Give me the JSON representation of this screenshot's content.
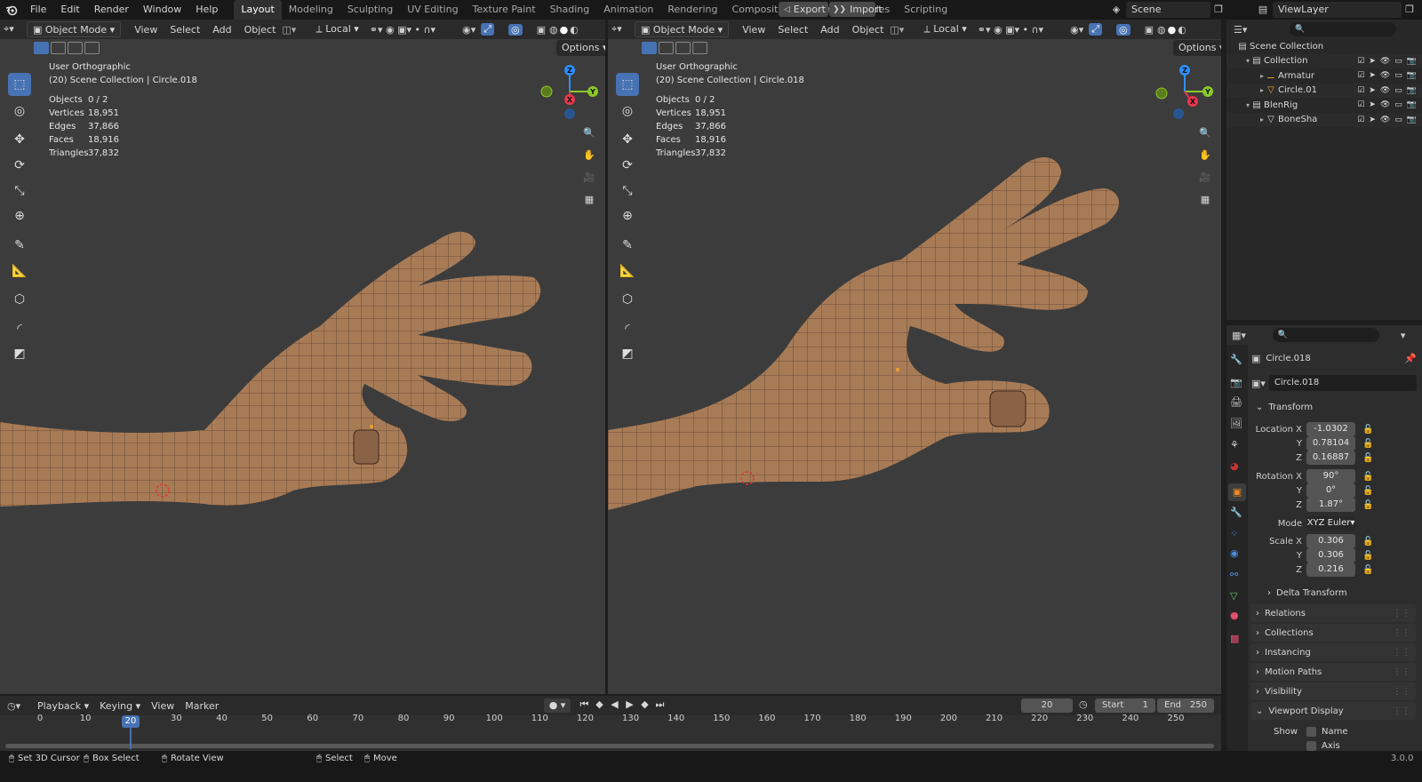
{
  "topbar": {
    "menus": [
      "File",
      "Edit",
      "Render",
      "Window",
      "Help"
    ],
    "workspaces": [
      "Layout",
      "Modeling",
      "Sculpting",
      "UV Editing",
      "Texture Paint",
      "Shading",
      "Animation",
      "Rendering",
      "Compositing",
      "Geometry Nodes",
      "Scripting"
    ],
    "active_workspace": "Layout",
    "export_label": "Export",
    "import_label": "Import",
    "scene_name": "Scene",
    "view_layer": "ViewLayer"
  },
  "viewport_header": {
    "mode": "Object Mode",
    "menus": [
      "View",
      "Select",
      "Add",
      "Object"
    ],
    "orientation": "Local",
    "options_label": "Options"
  },
  "viewport_left": {
    "view_name": "User Orthographic",
    "collection": "(20) Scene Collection | Circle.018",
    "stats": [
      {
        "label": "Objects",
        "value": "0 / 2"
      },
      {
        "label": "Vertices",
        "value": "18,951"
      },
      {
        "label": "Edges",
        "value": "37,866"
      },
      {
        "label": "Faces",
        "value": "18,916"
      },
      {
        "label": "Triangles",
        "value": "37,832"
      }
    ]
  },
  "viewport_right": {
    "view_name": "User Orthographic",
    "collection": "(20) Scene Collection | Circle.018",
    "stats": [
      {
        "label": "Objects",
        "value": "0 / 2"
      },
      {
        "label": "Vertices",
        "value": "18,951"
      },
      {
        "label": "Edges",
        "value": "37,866"
      },
      {
        "label": "Faces",
        "value": "18,916"
      },
      {
        "label": "Triangles",
        "value": "37,832"
      }
    ]
  },
  "gizmo": {
    "z": "Z",
    "y": "Y",
    "x": "X"
  },
  "outliner": {
    "items": [
      {
        "label": "Scene Collection",
        "indent": 0
      },
      {
        "label": "Collection",
        "indent": 1
      },
      {
        "label": "Armatur",
        "indent": 2
      },
      {
        "label": "Circle.01",
        "indent": 2
      },
      {
        "label": "BlenRig",
        "indent": 1
      },
      {
        "label": "BoneSha",
        "indent": 2
      }
    ]
  },
  "properties": {
    "object_name": "Circle.018",
    "object_name_field": "Circle.018",
    "transform_label": "Transform",
    "location_label": "Location X",
    "location": {
      "x": "-1.0302",
      "y": "0.78104",
      "z": "0.16887"
    },
    "rotation_label": "Rotation X",
    "rotation": {
      "x": "90°",
      "y": "0°",
      "z": "1.87°"
    },
    "mode_label": "Mode",
    "mode_value": "XYZ Euler",
    "scale_label": "Scale X",
    "scale": {
      "x": "0.306",
      "y": "0.306",
      "z": "0.216"
    },
    "axis_y": "Y",
    "axis_z": "Z",
    "delta_transform": "Delta Transform",
    "panels": [
      "Relations",
      "Collections",
      "Instancing",
      "Motion Paths",
      "Visibility",
      "Viewport Display"
    ],
    "show_label": "Show",
    "name_label": "Name",
    "axis_label": "Axis"
  },
  "timeline": {
    "menus": [
      "Playback",
      "Keying",
      "View",
      "Marker"
    ],
    "current_frame": "20",
    "start_label": "Start",
    "start_value": "1",
    "end_label": "End",
    "end_value": "250",
    "ticks": [
      "0",
      "10",
      "20",
      "30",
      "40",
      "50",
      "60",
      "70",
      "80",
      "90",
      "100",
      "110",
      "120",
      "130",
      "140",
      "150",
      "160",
      "170",
      "180",
      "190",
      "200",
      "210",
      "220",
      "230",
      "240",
      "250"
    ]
  },
  "statusbar": {
    "items": [
      "Set 3D Cursor",
      "Box Select",
      "Rotate View",
      "Select",
      "Move"
    ],
    "version": "3.0.0"
  },
  "colors": {
    "accent": "#4772b3",
    "viewport_bg": "#3c3c3c",
    "mesh": "#a87b57",
    "gizmo_x": "#e8364e",
    "gizmo_y": "#8bc926",
    "gizmo_z": "#2c8fff"
  }
}
